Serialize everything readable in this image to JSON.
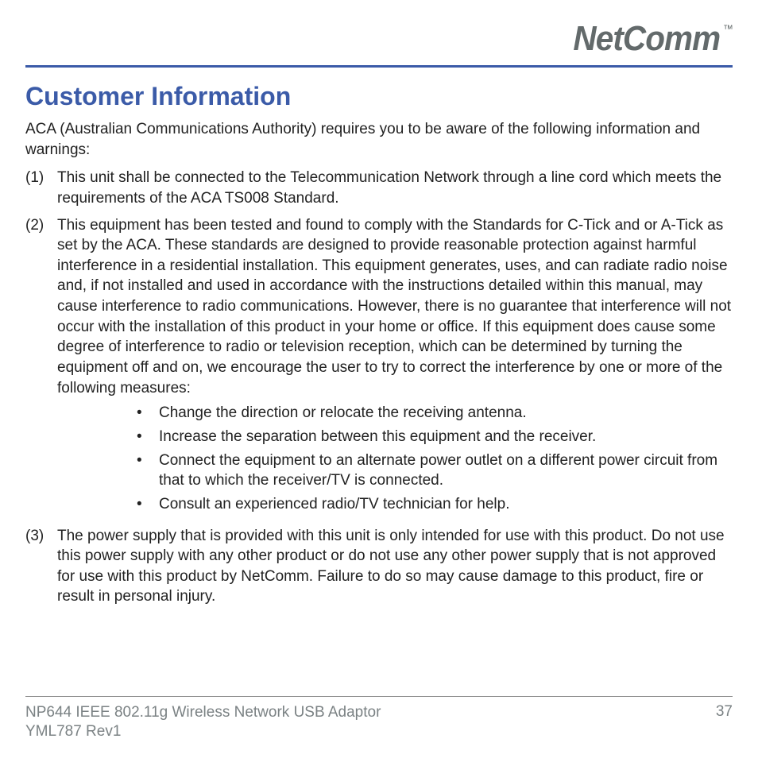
{
  "brand": {
    "name": "NetComm",
    "tm": "™"
  },
  "title": "Customer Information",
  "intro": "ACA (Australian Communications Authority) requires you to be aware of the following information and warnings:",
  "items": [
    {
      "num": "(1)",
      "text": "This unit shall be connected to the Telecommunication Network through a line cord which meets the requirements of the ACA TS008 Standard."
    },
    {
      "num": "(2)",
      "text": "This equipment has been tested and found to comply with the Standards for C-Tick and or A-Tick as set by the ACA. These standards are designed to provide reasonable protection against harmful interference in a residential installation. This equipment generates, uses, and can radiate radio noise and, if not installed and used in accordance with the instructions detailed within this manual, may cause interference to radio communications. However, there is no guarantee that interference will not occur with the installation of this product in your home or office. If this equipment does cause some degree of interference to radio or television reception, which can be determined by turning the equipment off and on, we encourage the user to try to correct the interference by one or more of the following measures:",
      "bullets": [
        "Change the direction or relocate the receiving antenna.",
        "Increase the separation between this equipment and the receiver.",
        "Connect the equipment to an alternate power outlet on a different power circuit from that to which the receiver/TV is connected.",
        "Consult an experienced radio/TV technician for help."
      ]
    },
    {
      "num": "(3)",
      "text": "The power supply that is provided with this unit is only intended for use with this product. Do not use this power supply with any other product or do not use any other power supply that is not approved for use with this product by NetComm. Failure to do so may cause damage to this product, fire or result in personal injury."
    }
  ],
  "footer": {
    "product": "NP644 IEEE 802.11g Wireless Network USB Adaptor",
    "rev": "YML787 Rev1",
    "page": "37"
  }
}
